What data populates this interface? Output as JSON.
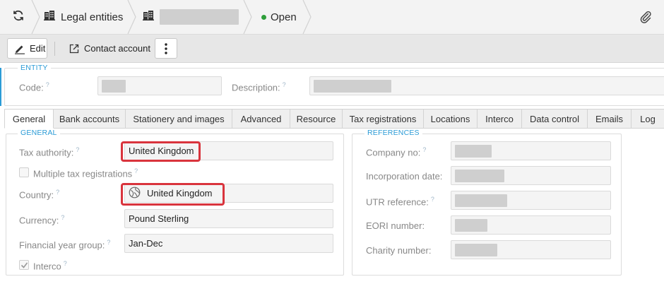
{
  "breadcrumb": {
    "refresh_icon": "refresh-icon",
    "legal_entities_label": "Legal entities",
    "status_label": "Open",
    "status_color": "#2e9e3a",
    "attachment_icon": "paperclip-icon"
  },
  "toolbar": {
    "edit_label": "Edit",
    "contact_label": "Contact account",
    "more_icon": "vertical-dots-icon"
  },
  "entity": {
    "legend": "ENTITY",
    "code_label": "Code:",
    "description_label": "Description:",
    "help_mark": "?"
  },
  "tabs": [
    "General",
    "Bank accounts",
    "Stationery and images",
    "Advanced",
    "Resource",
    "Tax registrations",
    "Locations",
    "Interco",
    "Data control",
    "Emails",
    "Log"
  ],
  "general": {
    "legend": "GENERAL",
    "tax_authority_label": "Tax authority:",
    "tax_authority_value": "United Kingdom",
    "multiple_tax_label": "Multiple tax registrations",
    "country_label": "Country:",
    "country_value": "United Kingdom",
    "currency_label": "Currency:",
    "currency_value": "Pound Sterling",
    "fy_group_label": "Financial year group:",
    "fy_group_value": "Jan-Dec",
    "interco_label": "Interco",
    "interco_checked": true
  },
  "references": {
    "legend": "REFERENCES",
    "company_no_label": "Company no:",
    "incorporation_date_label": "Incorporation date:",
    "utr_reference_label": "UTR reference:",
    "eori_number_label": "EORI number:",
    "charity_number_label": "Charity number:"
  },
  "colors": {
    "accent_blue": "#2b9bd6",
    "highlight_red": "#d9343d"
  }
}
